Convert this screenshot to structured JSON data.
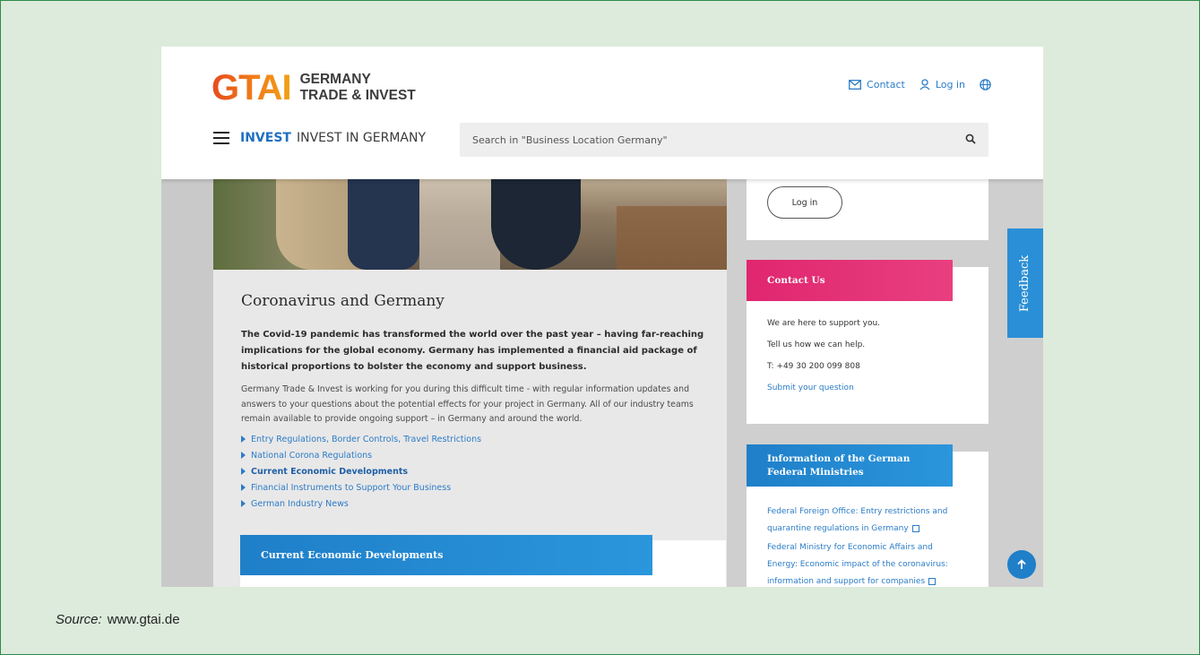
{
  "header": {
    "logo_mark": "GTAI",
    "logo_line1": "GERMANY",
    "logo_line2": "TRADE & INVEST",
    "contact_label": "Contact",
    "login_label": "Log in",
    "menu_invest": "INVEST",
    "menu_subtitle": "INVEST IN GERMANY",
    "search_placeholder": "Search in \"Business Location Germany\""
  },
  "article": {
    "title": "Coronavirus and Germany",
    "lead": "The Covid-19 pandemic has transformed the world over the past year – having far-reaching implications for the global economy. Germany has implemented a financial aid package of historical proportions to bolster the economy and support business.",
    "body": "Germany Trade & Invest is working for you during this difficult time - with regular information updates and answers to your questions about the potential effects for your project in Germany. All of our industry teams remain available to provide ongoing support – in Germany and around the world.",
    "links": [
      "Entry Regulations, Border Controls, Travel Restrictions",
      "National Corona Regulations",
      "Current Economic Developments",
      "Financial Instruments to Support Your Business",
      "German Industry News"
    ],
    "section_heading": "Current Economic Developments"
  },
  "sidebar": {
    "login_button": "Log in",
    "contact": {
      "heading": "Contact Us",
      "line1": "We are here to support you.",
      "line2": "Tell us how we can help.",
      "phone": "T: +49 30 200 099 808",
      "submit": "Submit your question"
    },
    "ministries": {
      "heading_line1": "Information of the German",
      "heading_line2": "Federal Ministries",
      "link1": "Federal Foreign Office: Entry restrictions and quarantine regulations in Germany",
      "link2": "Federal Ministry for Economic Affairs and Energy: Economic impact of the coronavirus: information and support for companies"
    }
  },
  "feedback_label": "Feedback",
  "caption": {
    "label": "Source:",
    "url": "www.gtai.de"
  },
  "colors": {
    "accent_blue": "#2a7cc7",
    "contact_pink": "#e0266f",
    "frame_green": "#2e8b4a"
  }
}
